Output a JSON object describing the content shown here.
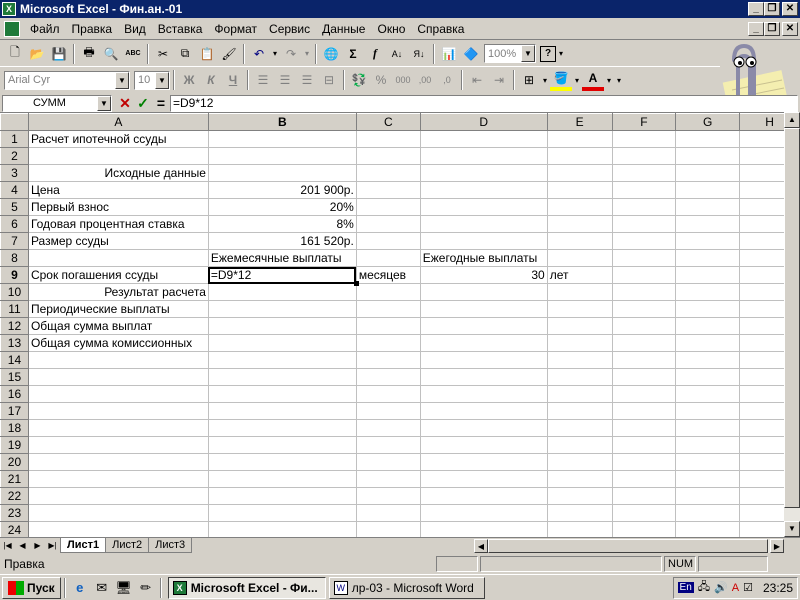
{
  "window": {
    "title": "Microsoft Excel - Фин.ан.-01",
    "app_icon": "excel-icon"
  },
  "menu": [
    "Файл",
    "Правка",
    "Вид",
    "Вставка",
    "Формат",
    "Сервис",
    "Данные",
    "Окно",
    "Справка"
  ],
  "toolbar_standard": {
    "zoom": "100%",
    "sum_symbol": "Σ",
    "fx_symbol": "f",
    "abc_label": "ABC"
  },
  "toolbar_format": {
    "font": "Arial Cyr",
    "size": "10",
    "bold": "Ж",
    "italic": "К",
    "underline": "Ч",
    "percent": "%",
    "thousands": "000",
    "dec_inc": ",00",
    "dec_dec": ",0"
  },
  "formula_bar": {
    "name_box": "СУММ",
    "formula": "=D9*12",
    "cancel": "✕",
    "ok": "✓",
    "equals": "="
  },
  "sheet": {
    "columns": [
      "A",
      "B",
      "C",
      "D",
      "E",
      "F",
      "G",
      "H"
    ],
    "rows": [
      {
        "n": "1",
        "A": "Расчет ипотечной ссуды",
        "B": "",
        "C": "",
        "D": "",
        "E": ""
      },
      {
        "n": "2",
        "A": "",
        "B": "",
        "C": "",
        "D": "",
        "E": ""
      },
      {
        "n": "3",
        "A": "Исходные данные",
        "B": "",
        "C": "",
        "D": "",
        "E": ""
      },
      {
        "n": "4",
        "A": "Цена",
        "B": "201 900р.",
        "C": "",
        "D": "",
        "E": ""
      },
      {
        "n": "5",
        "A": "Первый взнос",
        "B": "20%",
        "C": "",
        "D": "",
        "E": ""
      },
      {
        "n": "6",
        "A": "Годовая процентная ставка",
        "B": "8%",
        "C": "",
        "D": "",
        "E": ""
      },
      {
        "n": "7",
        "A": "Размер ссуды",
        "B": "161 520р.",
        "C": "",
        "D": "",
        "E": ""
      },
      {
        "n": "8",
        "A": "",
        "B": "Ежемесячные выплаты",
        "C": "",
        "D": "Ежегодные выплаты",
        "E": ""
      },
      {
        "n": "9",
        "A": "Срок погашения ссуды",
        "B": "=D9*12",
        "C": "месяцев",
        "D": "30",
        "E": "лет"
      },
      {
        "n": "10",
        "A": "Результат расчета",
        "B": "",
        "C": "",
        "D": "",
        "E": ""
      },
      {
        "n": "11",
        "A": "Периодические выплаты",
        "B": "",
        "C": "",
        "D": "",
        "E": ""
      },
      {
        "n": "12",
        "A": "Общая сумма выплат",
        "B": "",
        "C": "",
        "D": "",
        "E": ""
      },
      {
        "n": "13",
        "A": "Общая сумма комиссионных",
        "B": "",
        "C": "",
        "D": "",
        "E": ""
      },
      {
        "n": "14"
      },
      {
        "n": "15"
      },
      {
        "n": "16"
      },
      {
        "n": "17"
      },
      {
        "n": "18"
      },
      {
        "n": "19"
      },
      {
        "n": "20"
      },
      {
        "n": "21"
      },
      {
        "n": "22"
      },
      {
        "n": "23"
      },
      {
        "n": "24"
      }
    ]
  },
  "tabs": [
    "Лист1",
    "Лист2",
    "Лист3"
  ],
  "status": {
    "text": "Правка",
    "num": "NUM"
  },
  "taskbar": {
    "start": "Пуск",
    "tasks": [
      {
        "label": "Microsoft Excel - Фи...",
        "active": true
      },
      {
        "label": "лр-03 - Microsoft Word",
        "active": false
      }
    ],
    "lang": "En",
    "clock": "23:25"
  },
  "colors": {
    "titlebar": "#0a246a",
    "face": "#d4d0c8",
    "excel_green": "#1f7a3a"
  }
}
